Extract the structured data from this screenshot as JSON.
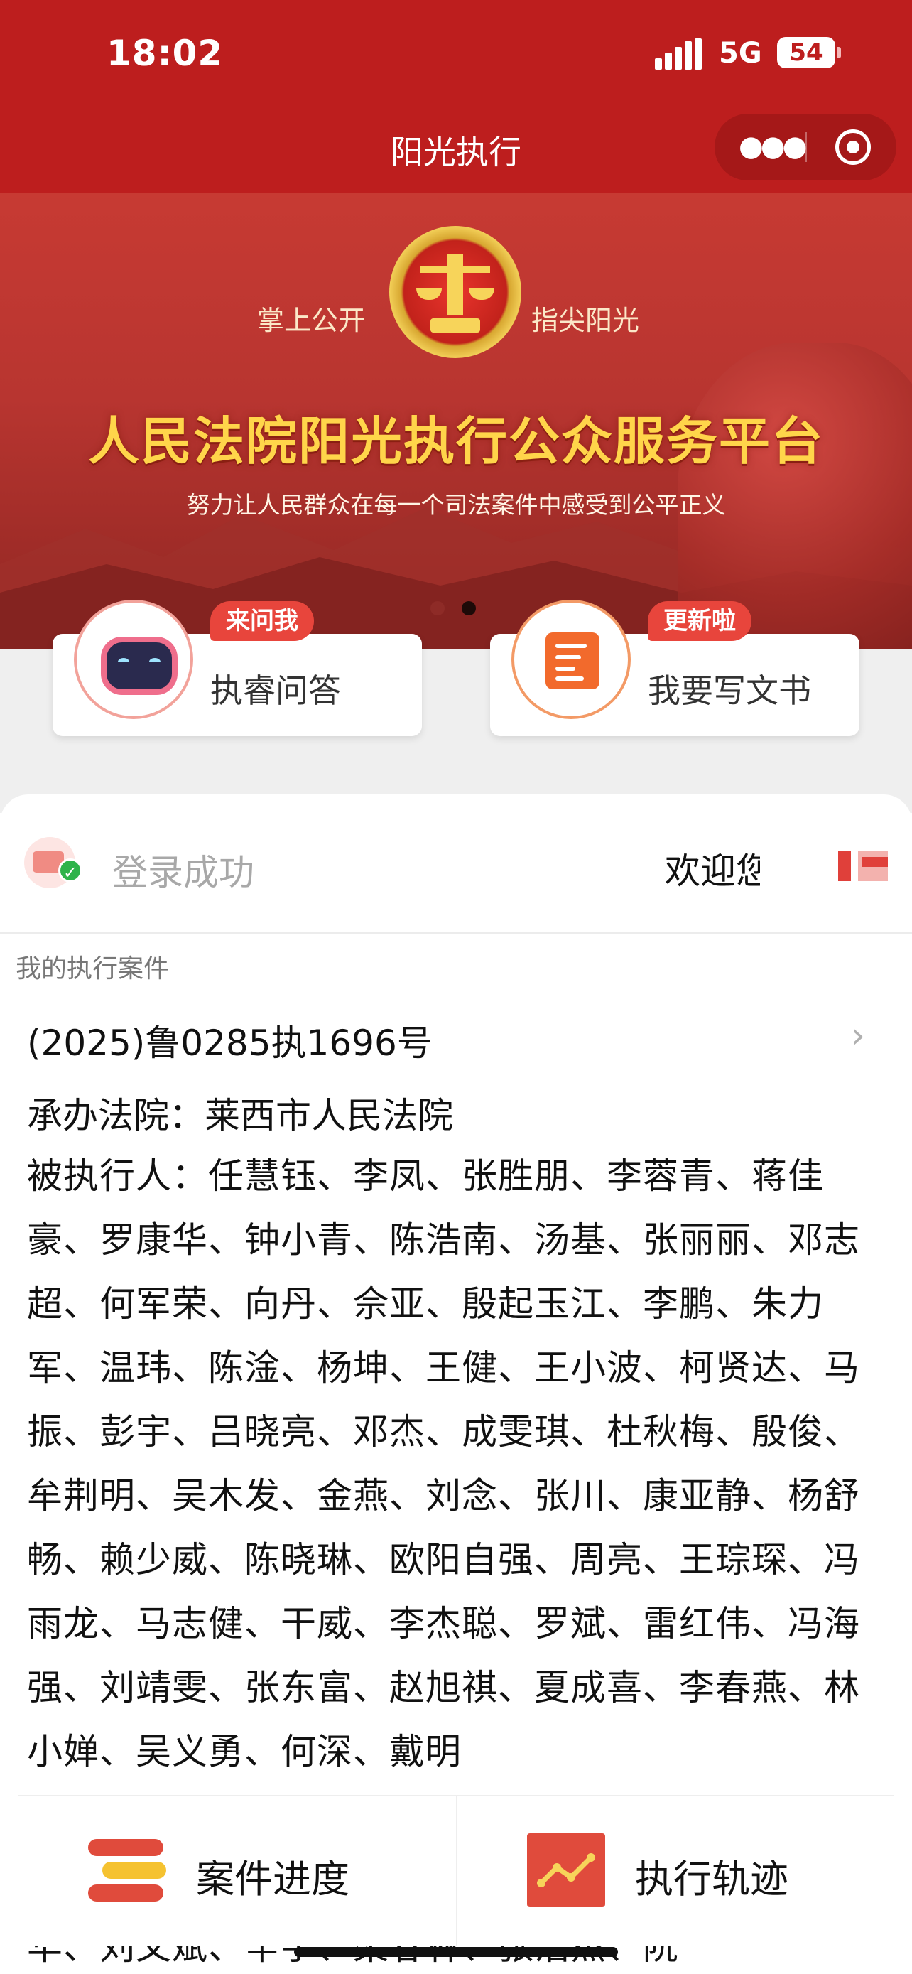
{
  "status_bar": {
    "time": "18:02",
    "network": "5G",
    "battery": "54"
  },
  "header": {
    "title": "阳光执行",
    "more_icon": "more-dots-icon",
    "close_icon": "target-icon",
    "accent": "#bd1e1e"
  },
  "banner": {
    "slogan_left": "掌上公开",
    "slogan_right": "指尖阳光",
    "title": "人民法院阳光执行公众服务平台",
    "subtitle": "努力让人民群众在每一个司法案件中感受到公平正义",
    "active_slide": 2,
    "total_slides": 2
  },
  "features": [
    {
      "badge": "来问我",
      "label": "执睿问答",
      "icon": "robot-icon"
    },
    {
      "badge": "更新啦",
      "label": "我要写文书",
      "icon": "document-edit-icon"
    }
  ],
  "login": {
    "status": "登录成功",
    "welcome": "欢迎您"
  },
  "cases": {
    "section_title": "我的执行案件",
    "items": [
      {
        "case_no": "(2025)鲁0285执1696号",
        "court": "承办法院：莱西市人民法院",
        "parties": "被执行人：任慧钰、李凤、张胜朋、李蓉青、蒋佳豪、罗康华、钟小青、陈浩南、汤基、张丽丽、邓志超、何军荣、向丹、佘亚、殷起玉江、李鹏、朱力军、温玮、陈淦、杨坤、王健、王小波、柯贤达、马振、彭宇、吕晓亮、邓杰、成雯琪、杜秋梅、殷俊、牟荆明、吴木发、金燕、刘念、张川、康亚静、杨舒畅、赖少威、陈晓琳、欧阳自强、周亮、王琮琛、冯雨龙、马志健、干威、李杰聪、罗斌、雷红伟、冯海强、刘靖雯、张东富、赵旭祺、夏成喜、李春燕、林小婵、吴义勇、何深、戴明",
        "overflow_text": "华、刘文斌、辛宇、梁春林、张浩杰、阮"
      }
    ]
  },
  "bottom_nav": [
    {
      "label": "案件进度",
      "icon": "progress-list-icon"
    },
    {
      "label": "执行轨迹",
      "icon": "trend-line-icon"
    }
  ]
}
